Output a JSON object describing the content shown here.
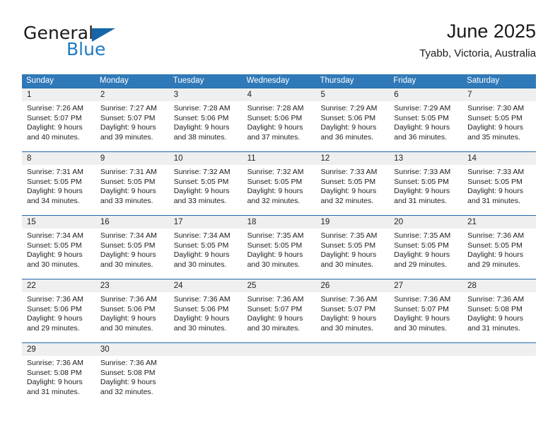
{
  "brand": {
    "name_part1": "General",
    "name_part2": "Blue",
    "flag_icon": "blue-triangle-flag-icon"
  },
  "header": {
    "title": "June 2025",
    "location": "Tyabb, Victoria, Australia"
  },
  "colors": {
    "header_blue": "#3079b8",
    "rule_blue": "#1f69ab",
    "day_band_gray": "#efefef",
    "brand_blue": "#1f7bc1",
    "text": "#1a1a1a"
  },
  "weekdays": [
    "Sunday",
    "Monday",
    "Tuesday",
    "Wednesday",
    "Thursday",
    "Friday",
    "Saturday"
  ],
  "weeks": [
    [
      {
        "day": "1",
        "sunrise": "Sunrise: 7:26 AM",
        "sunset": "Sunset: 5:07 PM",
        "daylight1": "Daylight: 9 hours",
        "daylight2": "and 40 minutes."
      },
      {
        "day": "2",
        "sunrise": "Sunrise: 7:27 AM",
        "sunset": "Sunset: 5:07 PM",
        "daylight1": "Daylight: 9 hours",
        "daylight2": "and 39 minutes."
      },
      {
        "day": "3",
        "sunrise": "Sunrise: 7:28 AM",
        "sunset": "Sunset: 5:06 PM",
        "daylight1": "Daylight: 9 hours",
        "daylight2": "and 38 minutes."
      },
      {
        "day": "4",
        "sunrise": "Sunrise: 7:28 AM",
        "sunset": "Sunset: 5:06 PM",
        "daylight1": "Daylight: 9 hours",
        "daylight2": "and 37 minutes."
      },
      {
        "day": "5",
        "sunrise": "Sunrise: 7:29 AM",
        "sunset": "Sunset: 5:06 PM",
        "daylight1": "Daylight: 9 hours",
        "daylight2": "and 36 minutes."
      },
      {
        "day": "6",
        "sunrise": "Sunrise: 7:29 AM",
        "sunset": "Sunset: 5:05 PM",
        "daylight1": "Daylight: 9 hours",
        "daylight2": "and 36 minutes."
      },
      {
        "day": "7",
        "sunrise": "Sunrise: 7:30 AM",
        "sunset": "Sunset: 5:05 PM",
        "daylight1": "Daylight: 9 hours",
        "daylight2": "and 35 minutes."
      }
    ],
    [
      {
        "day": "8",
        "sunrise": "Sunrise: 7:31 AM",
        "sunset": "Sunset: 5:05 PM",
        "daylight1": "Daylight: 9 hours",
        "daylight2": "and 34 minutes."
      },
      {
        "day": "9",
        "sunrise": "Sunrise: 7:31 AM",
        "sunset": "Sunset: 5:05 PM",
        "daylight1": "Daylight: 9 hours",
        "daylight2": "and 33 minutes."
      },
      {
        "day": "10",
        "sunrise": "Sunrise: 7:32 AM",
        "sunset": "Sunset: 5:05 PM",
        "daylight1": "Daylight: 9 hours",
        "daylight2": "and 33 minutes."
      },
      {
        "day": "11",
        "sunrise": "Sunrise: 7:32 AM",
        "sunset": "Sunset: 5:05 PM",
        "daylight1": "Daylight: 9 hours",
        "daylight2": "and 32 minutes."
      },
      {
        "day": "12",
        "sunrise": "Sunrise: 7:33 AM",
        "sunset": "Sunset: 5:05 PM",
        "daylight1": "Daylight: 9 hours",
        "daylight2": "and 32 minutes."
      },
      {
        "day": "13",
        "sunrise": "Sunrise: 7:33 AM",
        "sunset": "Sunset: 5:05 PM",
        "daylight1": "Daylight: 9 hours",
        "daylight2": "and 31 minutes."
      },
      {
        "day": "14",
        "sunrise": "Sunrise: 7:33 AM",
        "sunset": "Sunset: 5:05 PM",
        "daylight1": "Daylight: 9 hours",
        "daylight2": "and 31 minutes."
      }
    ],
    [
      {
        "day": "15",
        "sunrise": "Sunrise: 7:34 AM",
        "sunset": "Sunset: 5:05 PM",
        "daylight1": "Daylight: 9 hours",
        "daylight2": "and 30 minutes."
      },
      {
        "day": "16",
        "sunrise": "Sunrise: 7:34 AM",
        "sunset": "Sunset: 5:05 PM",
        "daylight1": "Daylight: 9 hours",
        "daylight2": "and 30 minutes."
      },
      {
        "day": "17",
        "sunrise": "Sunrise: 7:34 AM",
        "sunset": "Sunset: 5:05 PM",
        "daylight1": "Daylight: 9 hours",
        "daylight2": "and 30 minutes."
      },
      {
        "day": "18",
        "sunrise": "Sunrise: 7:35 AM",
        "sunset": "Sunset: 5:05 PM",
        "daylight1": "Daylight: 9 hours",
        "daylight2": "and 30 minutes."
      },
      {
        "day": "19",
        "sunrise": "Sunrise: 7:35 AM",
        "sunset": "Sunset: 5:05 PM",
        "daylight1": "Daylight: 9 hours",
        "daylight2": "and 30 minutes."
      },
      {
        "day": "20",
        "sunrise": "Sunrise: 7:35 AM",
        "sunset": "Sunset: 5:05 PM",
        "daylight1": "Daylight: 9 hours",
        "daylight2": "and 29 minutes."
      },
      {
        "day": "21",
        "sunrise": "Sunrise: 7:36 AM",
        "sunset": "Sunset: 5:05 PM",
        "daylight1": "Daylight: 9 hours",
        "daylight2": "and 29 minutes."
      }
    ],
    [
      {
        "day": "22",
        "sunrise": "Sunrise: 7:36 AM",
        "sunset": "Sunset: 5:06 PM",
        "daylight1": "Daylight: 9 hours",
        "daylight2": "and 29 minutes."
      },
      {
        "day": "23",
        "sunrise": "Sunrise: 7:36 AM",
        "sunset": "Sunset: 5:06 PM",
        "daylight1": "Daylight: 9 hours",
        "daylight2": "and 30 minutes."
      },
      {
        "day": "24",
        "sunrise": "Sunrise: 7:36 AM",
        "sunset": "Sunset: 5:06 PM",
        "daylight1": "Daylight: 9 hours",
        "daylight2": "and 30 minutes."
      },
      {
        "day": "25",
        "sunrise": "Sunrise: 7:36 AM",
        "sunset": "Sunset: 5:07 PM",
        "daylight1": "Daylight: 9 hours",
        "daylight2": "and 30 minutes."
      },
      {
        "day": "26",
        "sunrise": "Sunrise: 7:36 AM",
        "sunset": "Sunset: 5:07 PM",
        "daylight1": "Daylight: 9 hours",
        "daylight2": "and 30 minutes."
      },
      {
        "day": "27",
        "sunrise": "Sunrise: 7:36 AM",
        "sunset": "Sunset: 5:07 PM",
        "daylight1": "Daylight: 9 hours",
        "daylight2": "and 30 minutes."
      },
      {
        "day": "28",
        "sunrise": "Sunrise: 7:36 AM",
        "sunset": "Sunset: 5:08 PM",
        "daylight1": "Daylight: 9 hours",
        "daylight2": "and 31 minutes."
      }
    ],
    [
      {
        "day": "29",
        "sunrise": "Sunrise: 7:36 AM",
        "sunset": "Sunset: 5:08 PM",
        "daylight1": "Daylight: 9 hours",
        "daylight2": "and 31 minutes."
      },
      {
        "day": "30",
        "sunrise": "Sunrise: 7:36 AM",
        "sunset": "Sunset: 5:08 PM",
        "daylight1": "Daylight: 9 hours",
        "daylight2": "and 32 minutes."
      },
      {
        "day": "",
        "sunrise": "",
        "sunset": "",
        "daylight1": "",
        "daylight2": ""
      },
      {
        "day": "",
        "sunrise": "",
        "sunset": "",
        "daylight1": "",
        "daylight2": ""
      },
      {
        "day": "",
        "sunrise": "",
        "sunset": "",
        "daylight1": "",
        "daylight2": ""
      },
      {
        "day": "",
        "sunrise": "",
        "sunset": "",
        "daylight1": "",
        "daylight2": ""
      },
      {
        "day": "",
        "sunrise": "",
        "sunset": "",
        "daylight1": "",
        "daylight2": ""
      }
    ]
  ]
}
